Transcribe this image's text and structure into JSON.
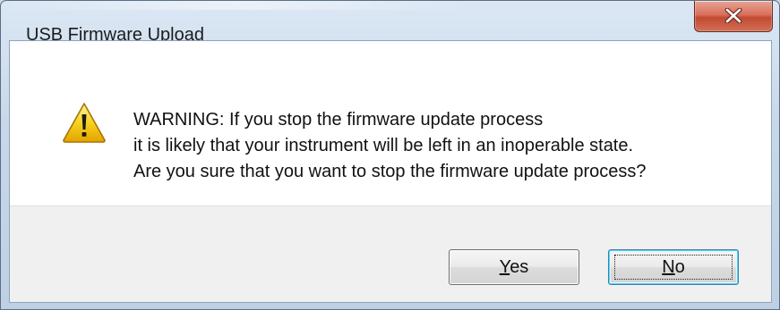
{
  "window": {
    "title": "USB Firmware Upload",
    "close_glyph": "X"
  },
  "dialog": {
    "icon": "warning-icon",
    "message_lines": [
      "WARNING: If you stop the firmware update process",
      "it is likely that your instrument will be left in an inoperable state.",
      "Are you sure that you want to stop the firmware update process?"
    ]
  },
  "buttons": {
    "yes": {
      "mnemonic": "Y",
      "rest": "es"
    },
    "no": {
      "mnemonic": "N",
      "rest": "o"
    }
  },
  "colors": {
    "close_button": "#c9553d",
    "warning_yellow": "#f5c400",
    "focus_border": "#3c7fb1"
  }
}
